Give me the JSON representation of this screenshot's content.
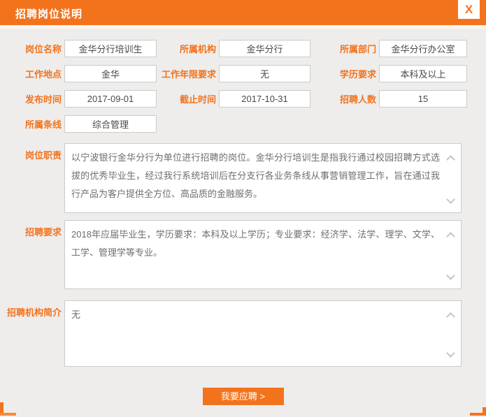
{
  "dialog": {
    "title": "招聘岗位说明",
    "close_label": "X"
  },
  "fields": {
    "position_name": {
      "label": "岗位名称",
      "value": "金华分行培训生"
    },
    "organization": {
      "label": "所属机构",
      "value": "金华分行"
    },
    "department": {
      "label": "所属部门",
      "value": "金华分行办公室"
    },
    "work_location": {
      "label": "工作地点",
      "value": "金华"
    },
    "experience": {
      "label": "工作年限要求",
      "value": "无"
    },
    "education": {
      "label": "学历要求",
      "value": "本科及以上"
    },
    "publish_date": {
      "label": "发布时间",
      "value": "2017-09-01"
    },
    "deadline": {
      "label": "截止时间",
      "value": "2017-10-31"
    },
    "headcount": {
      "label": "招聘人数",
      "value": "15"
    },
    "business_line": {
      "label": "所属条线",
      "value": "综合管理"
    },
    "responsibilities": {
      "label": "岗位职责",
      "value": "以宁波银行金华分行为单位进行招聘的岗位。金华分行培训生是指我行通过校园招聘方式选拔的优秀毕业生，经过我行系统培训后在分支行各业务条线从事营销管理工作，旨在通过我行产品为客户提供全方位、高品质的金融服务。"
    },
    "requirements": {
      "label": "招聘要求",
      "value": "2018年应届毕业生，学历要求：本科及以上学历；专业要求：经济学、法学、理学、文学、工学、管理学等专业。"
    },
    "org_intro": {
      "label": "招聘机构简介",
      "value": "无"
    }
  },
  "apply_button": {
    "label": "我要应聘 >"
  },
  "colors": {
    "accent": "#f3731d",
    "background": "#eeedeb"
  }
}
